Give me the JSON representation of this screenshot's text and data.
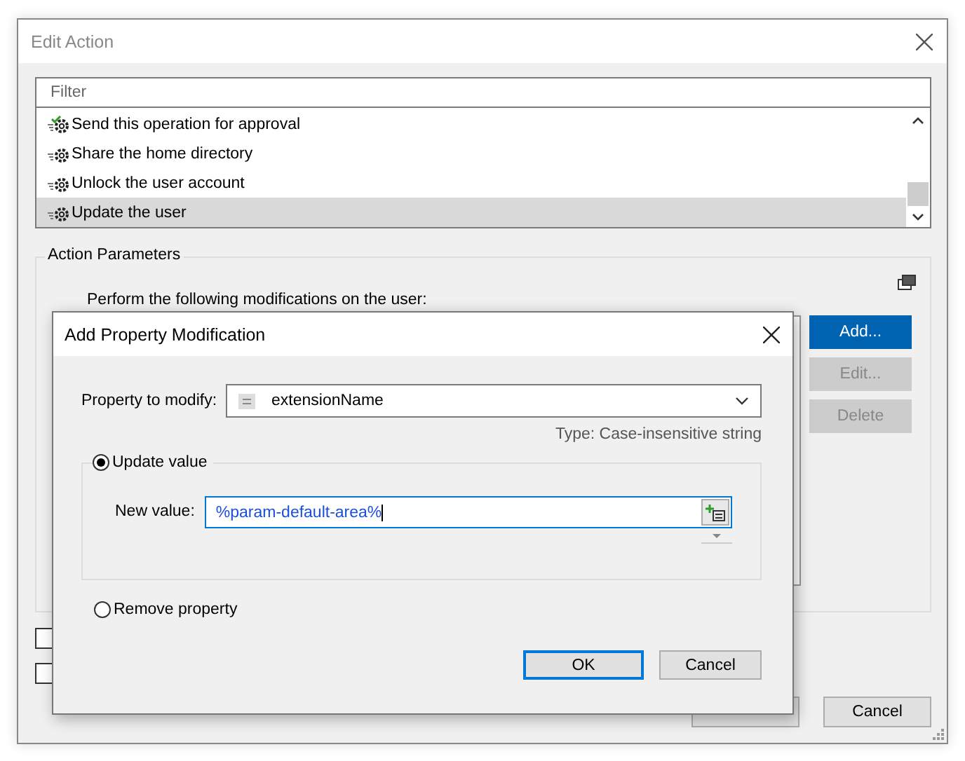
{
  "window": {
    "title": "Edit Action"
  },
  "action_list": {
    "placeholder": "Filter",
    "items": [
      {
        "label": "Send this operation for approval",
        "kind": "approval",
        "selected": false
      },
      {
        "label": "Share the home directory",
        "kind": "action",
        "selected": false
      },
      {
        "label": "Unlock the user account",
        "kind": "action",
        "selected": false
      },
      {
        "label": "Update the user",
        "kind": "action",
        "selected": true
      }
    ]
  },
  "action_parameters": {
    "title": "Action Parameters",
    "description": "Perform the following modifications on the user:",
    "buttons": [
      {
        "label": "Add...",
        "disabled": false,
        "primary": true
      },
      {
        "label": "Edit...",
        "disabled": true,
        "primary": false
      },
      {
        "label": "Delete",
        "disabled": true,
        "primary": false
      }
    ]
  },
  "checkboxes": [
    {
      "checked": false
    },
    {
      "checked": false
    }
  ],
  "buttons": [
    {
      "kind": "covered"
    },
    {
      "kind": "plain",
      "label": "Cancel"
    }
  ],
  "modal": {
    "title": "Add Property Modification",
    "property_label": "Property to modify:",
    "property_value": "extensionName",
    "type_text": "Type: Case-insensitive string",
    "options": [
      {
        "label": "Update value",
        "selected": true
      },
      {
        "label": "Remove property",
        "selected": false
      }
    ],
    "new_value_label": "New value:",
    "new_value": "%param-default-area%",
    "buttons": [
      {
        "label": "OK",
        "focused": true
      },
      {
        "label": "Cancel",
        "focused": false
      }
    ]
  }
}
